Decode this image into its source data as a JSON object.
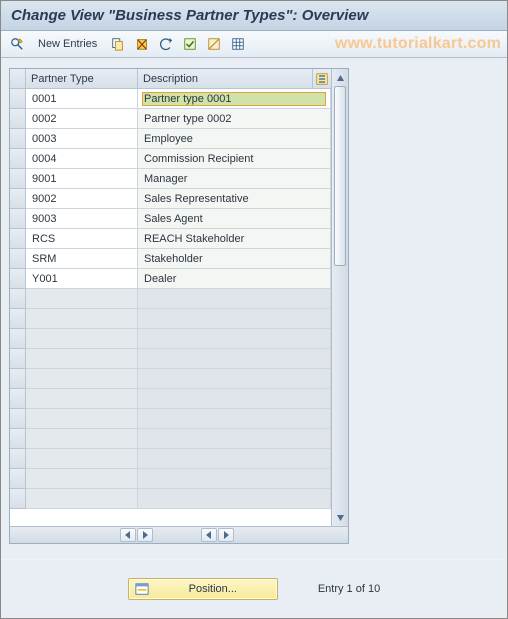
{
  "title": "Change View \"Business Partner Types\": Overview",
  "watermark": "www.tutorialkart.com",
  "toolbar": {
    "new_entries": "New Entries"
  },
  "columns": {
    "partner_type": "Partner Type",
    "description": "Description"
  },
  "rows": [
    {
      "pt": "0001",
      "desc": "Partner type 0001",
      "selected": true
    },
    {
      "pt": "0002",
      "desc": "Partner type 0002"
    },
    {
      "pt": "0003",
      "desc": "Employee"
    },
    {
      "pt": "0004",
      "desc": "Commission Recipient"
    },
    {
      "pt": "9001",
      "desc": "Manager"
    },
    {
      "pt": "9002",
      "desc": "Sales Representative"
    },
    {
      "pt": "9003",
      "desc": "Sales Agent"
    },
    {
      "pt": "RCS",
      "desc": "REACH Stakeholder"
    },
    {
      "pt": "SRM",
      "desc": "Stakeholder"
    },
    {
      "pt": "Y001",
      "desc": "Dealer"
    }
  ],
  "empty_row_count": 11,
  "footer": {
    "position_label": "Position...",
    "entry_label": "Entry 1 of 10"
  }
}
